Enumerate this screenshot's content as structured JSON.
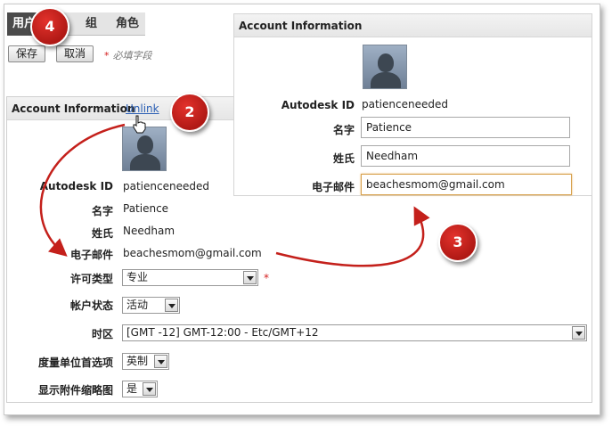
{
  "tabs": [
    {
      "label": "用户",
      "active": true
    },
    {
      "label": "组",
      "active": false
    },
    {
      "label": "角色",
      "active": false
    }
  ],
  "toolbar": {
    "save_label": "保存",
    "cancel_label": "取消",
    "required_star": "*",
    "required_note": "必填字段"
  },
  "main_panel": {
    "title": "Account Information",
    "unlink_label": "Unlink",
    "avatar_icon": "user-silhouette-icon",
    "fields": {
      "autodesk_id": {
        "label": "Autodesk ID",
        "value": "patienceneeded"
      },
      "first_name": {
        "label": "名字",
        "value": "Patience"
      },
      "last_name": {
        "label": "姓氏",
        "value": "Needham"
      },
      "email": {
        "label": "电子邮件",
        "value": "beachesmom@gmail.com"
      },
      "license_type": {
        "label": "许可类型",
        "value": "专业",
        "required_star": "*"
      },
      "account_status": {
        "label": "帐户状态",
        "value": "活动"
      },
      "timezone": {
        "label": "时区",
        "value": "[GMT -12] GMT-12:00 - Etc/GMT+12"
      },
      "units": {
        "label": "度量单位首选项",
        "value": "英制"
      },
      "thumbnails": {
        "label": "显示附件缩略图",
        "value": "是"
      }
    }
  },
  "overlay_panel": {
    "title": "Account Information",
    "avatar_icon": "user-silhouette-icon",
    "fields": {
      "autodesk_id": {
        "label": "Autodesk ID",
        "value": "patienceneeded"
      },
      "first_name": {
        "label": "名字",
        "value": "Patience"
      },
      "last_name": {
        "label": "姓氏",
        "value": "Needham"
      },
      "email": {
        "label": "电子邮件",
        "value": "beachesmom@gmail.com"
      }
    }
  },
  "callouts": {
    "two": "2",
    "three": "3",
    "four": "4"
  },
  "colors": {
    "callout": "#c4201b",
    "link": "#2b5fb4",
    "required": "#d42020",
    "focus_border": "#d8a24f"
  }
}
